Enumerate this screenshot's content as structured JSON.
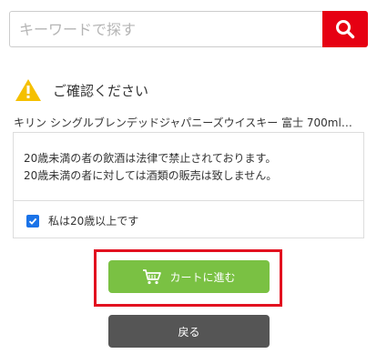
{
  "search": {
    "placeholder": "キーワードで探す"
  },
  "confirm": {
    "title": "ご確認ください"
  },
  "product": {
    "name": "キリン シングルブレンデッドジャパニーズウイスキー 富士 700ml…"
  },
  "notice": {
    "line1": "20歳未満の者の飲酒は法律で禁止されております。",
    "line2": "20歳未満の者に対しては酒類の販売は致しません。"
  },
  "age_check": {
    "label": "私は20歳以上です",
    "checked": true
  },
  "buttons": {
    "cart_label": "カートに進む",
    "back_label": "戻る"
  },
  "colors": {
    "search_button": "#e60012",
    "cart_button": "#7ac143",
    "back_button": "#555555",
    "highlight": "#e2101f",
    "warning": "#f5c000"
  },
  "icons": {
    "search": "search-icon",
    "warning": "warning-icon",
    "cart": "cart-icon",
    "check": "checkmark-icon"
  }
}
